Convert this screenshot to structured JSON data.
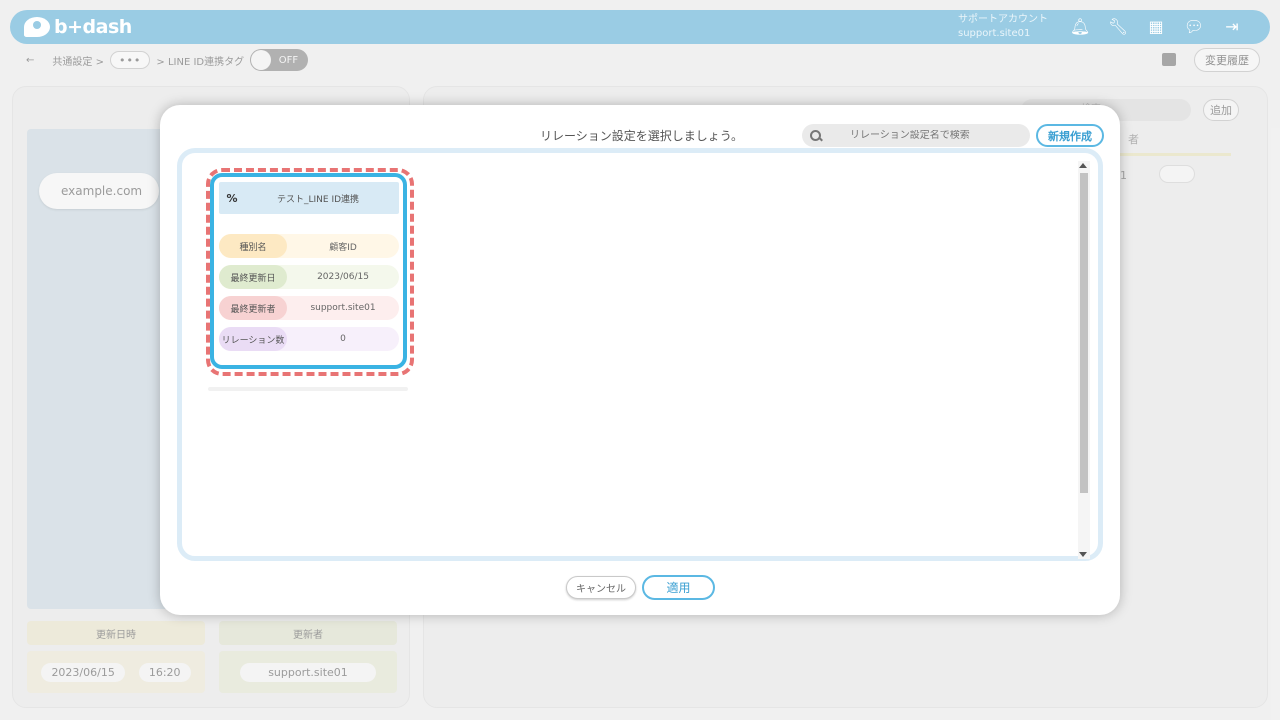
{
  "header": {
    "logo_text": "b+dash",
    "account_line1": "サポートアカウント",
    "account_line2": "support.site01",
    "icons": [
      "bell-icon",
      "wrench-icon",
      "grid-icon",
      "chat-icon",
      "logout-icon"
    ]
  },
  "breadcrumb": {
    "back": "←",
    "item1": "共通設定 >",
    "ellipsis": "•••",
    "item2": "> LINE ID連携タグ",
    "toggle_label": "OFF",
    "history_label": "変更履歴"
  },
  "left_panel": {
    "domain": "example.com",
    "col_updated": "更新日時",
    "col_updater": "更新者",
    "date": "2023/06/15",
    "time": "16:20",
    "updater": "support.site01"
  },
  "right_panel": {
    "search_placeholder": "検索",
    "add_label": "追加",
    "col_partial": "者",
    "cell_partial": "01"
  },
  "modal": {
    "title": "リレーション設定を選択しましょう。",
    "search_placeholder": "リレーション設定名で検索",
    "new_label": "新規作成",
    "cancel_label": "キャンセル",
    "apply_label": "適用",
    "card": {
      "title": "テスト_LINE ID連携",
      "icon_glyph": "%",
      "rows": [
        {
          "label": "種別名",
          "value": "顧客ID"
        },
        {
          "label": "最終更新日",
          "value": "2023/06/15"
        },
        {
          "label": "最終更新者",
          "value": "support.site01"
        },
        {
          "label": "リレーション数",
          "value": "0"
        }
      ]
    }
  },
  "colors": {
    "header_blue": "#64b1d6",
    "accent_blue": "#3ab3e3",
    "highlight_red": "#e87474"
  }
}
